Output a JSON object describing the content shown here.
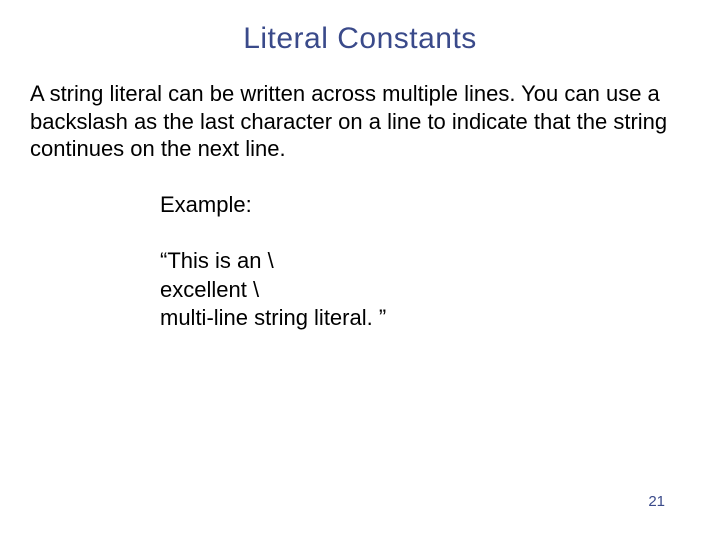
{
  "title": "Literal Constants",
  "body": "A string literal can be written across multiple lines. You can use a backslash as the last character on a line to indicate that the string continues on the next line.",
  "example": {
    "label": "Example:",
    "line1": "“This is an \\",
    "line2": "excellent \\",
    "line3": "multi-line string literal. ”"
  },
  "page_number": "21"
}
